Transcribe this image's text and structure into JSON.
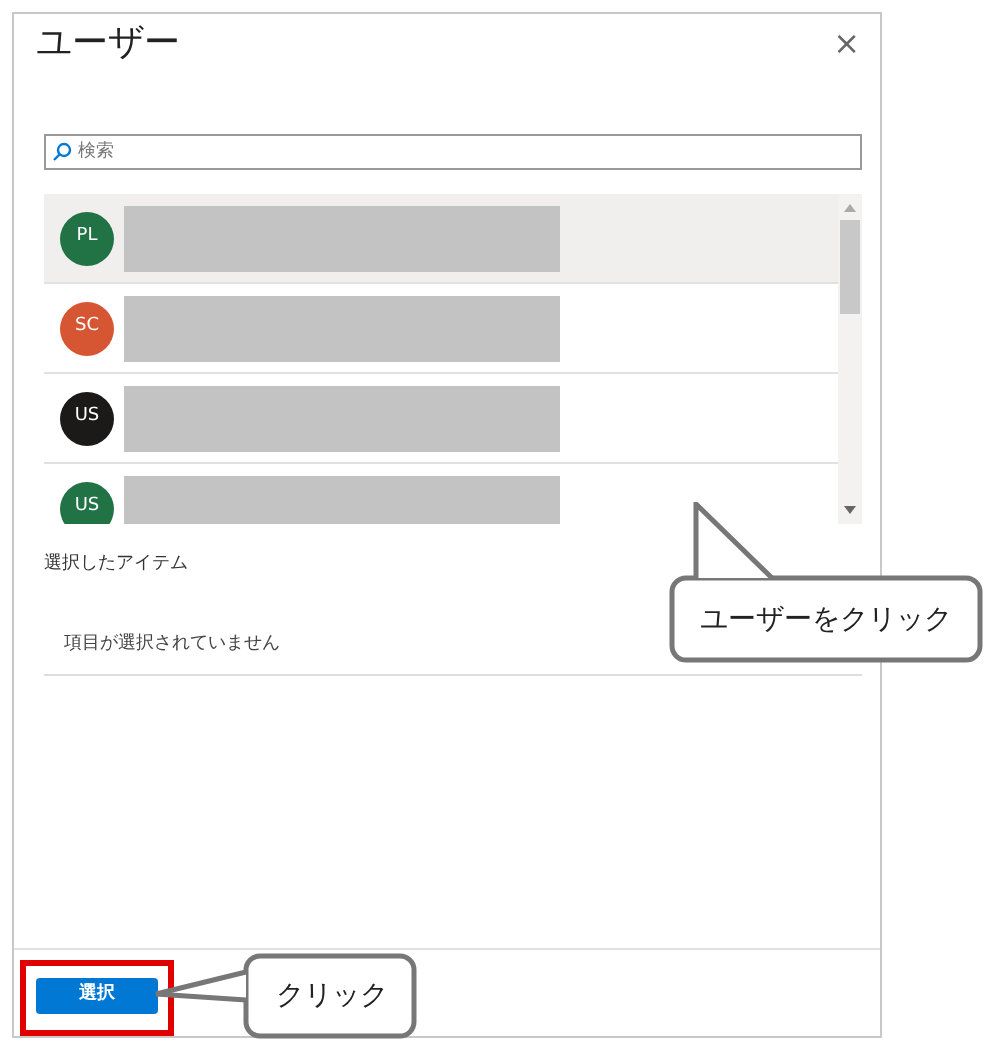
{
  "panel": {
    "title": "ユーザー",
    "close": "×"
  },
  "search": {
    "placeholder": "検索"
  },
  "users": [
    {
      "initials": "PL",
      "color": "#217346",
      "selected": true
    },
    {
      "initials": "SC",
      "color": "#d65532",
      "selected": false
    },
    {
      "initials": "US",
      "color": "#1b1a19",
      "selected": false
    },
    {
      "initials": "US",
      "color": "#217346",
      "selected": false
    }
  ],
  "selected_items": {
    "heading": "選択したアイテム",
    "empty_text": "項目が選択されていません"
  },
  "footer": {
    "select_button": "選択"
  },
  "callouts": [
    {
      "kind": "list",
      "text": "ユーザーをクリック"
    },
    {
      "kind": "button",
      "text": "クリック"
    }
  ]
}
